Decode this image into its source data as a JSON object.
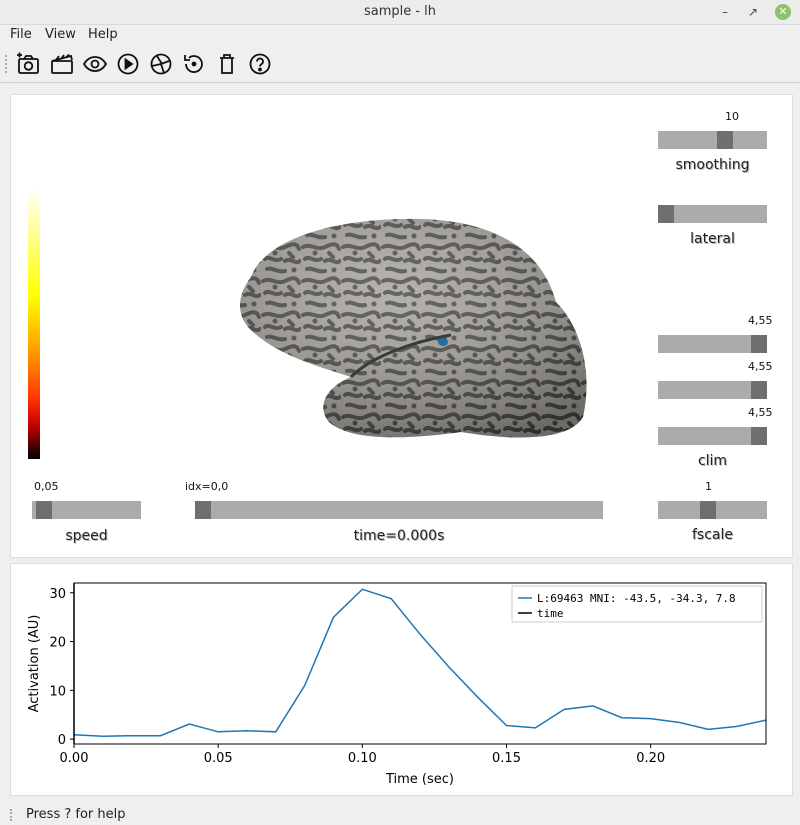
{
  "window": {
    "title": "sample - lh",
    "minimize": "–",
    "restore": "↗",
    "close": "✕"
  },
  "menu": [
    "File",
    "View",
    "Help"
  ],
  "toolbar": [
    "screenshot-icon",
    "movie-icon",
    "eye-icon",
    "play-icon",
    "reset-camera-icon",
    "restore-icon",
    "trash-icon",
    "help-icon"
  ],
  "sliders": {
    "smoothing": {
      "label": "smoothing",
      "value_label": "10",
      "fraction": 0.63
    },
    "lateral": {
      "label": "lateral",
      "fraction": 0.0
    },
    "clim": {
      "label": "clim",
      "values": [
        "4,55",
        "4,55",
        "4,55"
      ],
      "fractions": [
        1.0,
        1.0,
        1.0
      ]
    },
    "speed": {
      "label": "speed",
      "value_label": "0,05",
      "fraction": 0.04
    },
    "time": {
      "label": "time=0.000s",
      "value_label": "idx=0,0",
      "fraction": 0.0
    },
    "fscale": {
      "label": "fscale",
      "value_label": "1",
      "fraction": 0.45
    }
  },
  "status": "Press ? for help",
  "colors": {
    "line": "#1f77b4",
    "accent_close": "#8dc36a"
  },
  "chart_data": {
    "type": "line",
    "xlabel": "Time (sec)",
    "ylabel": "Activation (AU)",
    "xlim": [
      0.0,
      0.24
    ],
    "ylim": [
      -1,
      32
    ],
    "xticks": [
      "0.00",
      "0.05",
      "0.10",
      "0.15",
      "0.20"
    ],
    "xtick_values": [
      0.0,
      0.05,
      0.1,
      0.15,
      0.2
    ],
    "yticks": [
      "0",
      "10",
      "20",
      "30"
    ],
    "ytick_values": [
      0,
      10,
      20,
      30
    ],
    "legend": {
      "placement": "top-right",
      "entries": [
        "L:69463  MNI: -43.5, -34.3,   7.8",
        "time"
      ]
    },
    "series": [
      {
        "name": "L:69463  MNI: -43.5, -34.3,   7.8",
        "color": "#1f77b4",
        "x": [
          0.0,
          0.01,
          0.02,
          0.03,
          0.04,
          0.05,
          0.06,
          0.07,
          0.08,
          0.09,
          0.1,
          0.11,
          0.12,
          0.13,
          0.14,
          0.15,
          0.16,
          0.17,
          0.18,
          0.19,
          0.2,
          0.21,
          0.22,
          0.23,
          0.24
        ],
        "y": [
          0.9,
          0.6,
          0.7,
          0.7,
          3.1,
          1.5,
          1.7,
          1.5,
          11.0,
          25.0,
          30.7,
          28.8,
          21.5,
          14.8,
          8.6,
          2.8,
          2.3,
          6.1,
          6.8,
          4.4,
          4.2,
          3.4,
          2.0,
          2.6,
          3.9
        ]
      },
      {
        "name": "time",
        "color": "#000000",
        "x": [
          0.0,
          0.0
        ],
        "y": [
          -1,
          32
        ]
      }
    ]
  }
}
